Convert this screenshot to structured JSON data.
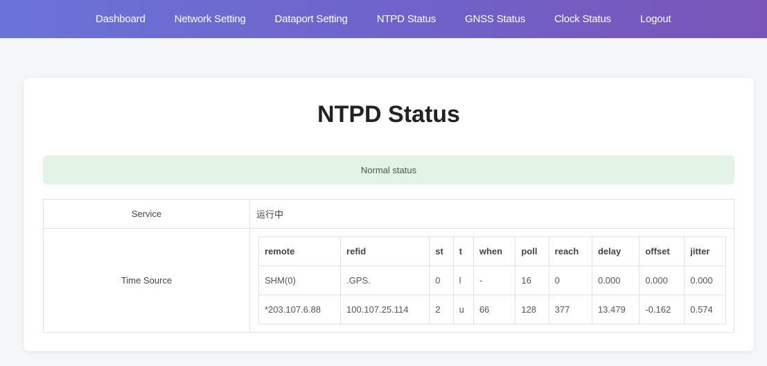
{
  "nav": {
    "items": [
      {
        "label": "Dashboard"
      },
      {
        "label": "Network Setting"
      },
      {
        "label": "Dataport Setting"
      },
      {
        "label": "NTPD Status"
      },
      {
        "label": "GNSS Status"
      },
      {
        "label": "Clock Status"
      },
      {
        "label": "Logout"
      }
    ]
  },
  "page": {
    "title": "NTPD Status",
    "status_message": "Normal status"
  },
  "info": {
    "service_label": "Service",
    "service_value": "运行中",
    "time_source_label": "Time Source"
  },
  "time_source": {
    "headers": [
      "remote",
      "refid",
      "st",
      "t",
      "when",
      "poll",
      "reach",
      "delay",
      "offset",
      "jitter"
    ],
    "rows": [
      [
        "SHM(0)",
        ".GPS.",
        "0",
        "l",
        "-",
        "16",
        "0",
        "0.000",
        "0.000",
        "0.000"
      ],
      [
        "*203.107.6.88",
        "100.107.25.114",
        "2",
        "u",
        "66",
        "128",
        "377",
        "13.479",
        "-0.162",
        "0.574"
      ]
    ]
  },
  "colors": {
    "nav_gradient_start": "#6b73d8",
    "nav_gradient_end": "#7a55b8",
    "status_background": "#e3f3e6"
  }
}
